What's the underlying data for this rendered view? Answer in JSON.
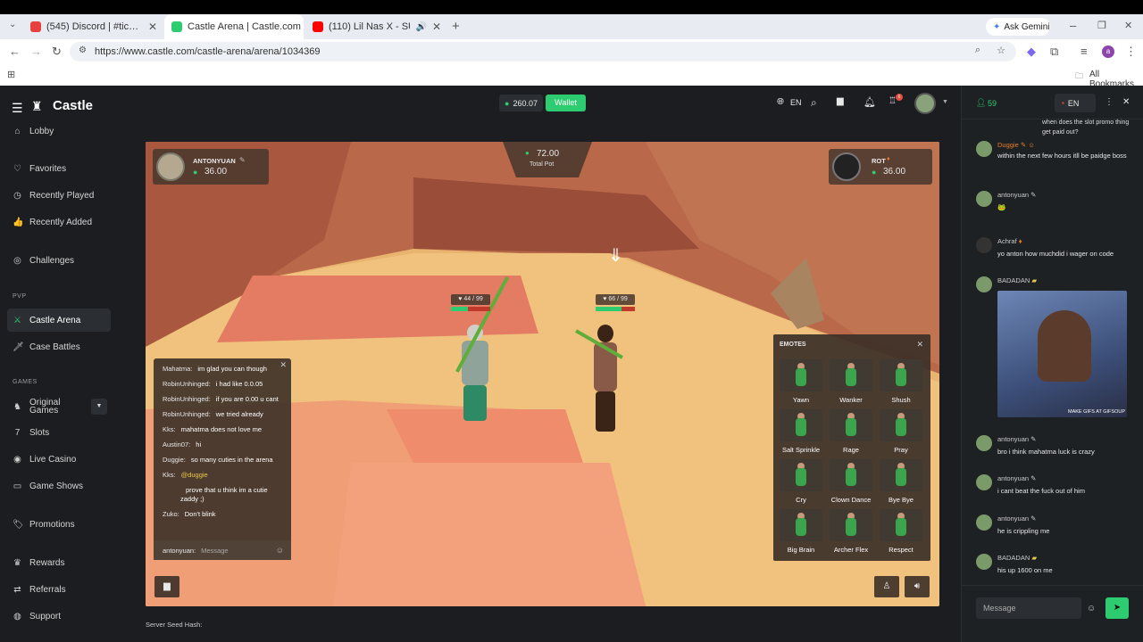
{
  "browser": {
    "tabs": [
      {
        "label": "(545) Discord | #ticket-0008 | c…",
        "icon": "discord-icon",
        "color": "#e8403f"
      },
      {
        "label": "Castle Arena | Castle.com",
        "icon": "castle-icon",
        "color": "#2ecc71"
      },
      {
        "label": "(110) Lil Nas X - SUN GOES…",
        "icon": "youtube-icon",
        "color": "#ff0000"
      }
    ],
    "gemini_label": "Ask Gemini",
    "url": "https://www.castle.com/castle-arena/arena/1034369",
    "bookmarks_label": "All Bookmarks",
    "profile_initial": "a"
  },
  "castle": {
    "brand": "Castle",
    "balance": "260.07",
    "wallet_label": "Wallet",
    "language": "EN",
    "notif_count": "6",
    "sidebar": {
      "items_top": [
        {
          "label": "Lobby",
          "icon": "lobby-icon"
        },
        {
          "label": "Favorites",
          "icon": "heart-icon"
        },
        {
          "label": "Recently Played",
          "icon": "clock-icon"
        },
        {
          "label": "Recently Added",
          "icon": "thumb-icon"
        },
        {
          "label": "Challenges",
          "icon": "target-icon"
        }
      ],
      "pvp_label": "PVP",
      "pvp_items": [
        {
          "label": "Castle Arena",
          "icon": "swords-icon"
        },
        {
          "label": "Case Battles",
          "icon": "sword-icon"
        }
      ],
      "games_label": "GAMES",
      "games_items": [
        {
          "label": "Original Games",
          "icon": "chess-icon"
        },
        {
          "label": "Slots",
          "icon": "slots-icon"
        },
        {
          "label": "Live Casino",
          "icon": "casino-icon"
        },
        {
          "label": "Game Shows",
          "icon": "shows-icon"
        }
      ],
      "bottom_items": [
        {
          "label": "Promotions",
          "icon": "tag-icon"
        },
        {
          "label": "Rewards",
          "icon": "crown-icon"
        },
        {
          "label": "Referrals",
          "icon": "share-icon"
        },
        {
          "label": "Support",
          "icon": "support-icon"
        }
      ]
    },
    "arena": {
      "player1": {
        "name": "ANTONYUAN",
        "amount": "36.00",
        "hp": "44 / 99",
        "hp_fraction": 0.44
      },
      "player2": {
        "name": "ROT",
        "amount": "36.00",
        "hp": "66 / 99",
        "hp_fraction": 0.67
      },
      "pot_amount": "72.00",
      "pot_label": "Total Pot",
      "chat": [
        {
          "user": "Mahatma:",
          "text": "im glad you can though"
        },
        {
          "user": "RobinUnhinged:",
          "text": "i had like 0.0.05"
        },
        {
          "user": "RobinUnhinged:",
          "text": "if you are 0.00 u cant"
        },
        {
          "user": "RobinUnhinged:",
          "text": "we tried already"
        },
        {
          "user": "Kks:",
          "text": "mahatma does not love me"
        },
        {
          "user": "Austin07:",
          "text": "hi"
        },
        {
          "user": "Duggie:",
          "text": "so many cuties in the arena"
        },
        {
          "user": "Kks:",
          "text": "@duggie"
        },
        {
          "user": "",
          "text": "prove that u think im a cutie zaddy ;)"
        },
        {
          "user": "Zuko:",
          "text": "Don't blink"
        }
      ],
      "chat_input_user": "antonyuan:",
      "chat_input_placeholder": "Message",
      "emotes_title": "EMOTES",
      "emotes": [
        "Yawn",
        "Wanker",
        "Shush",
        "Salt Sprinkle",
        "Rage",
        "Pray",
        "Cry",
        "Clown Dance",
        "Bye Bye",
        "Big Brain",
        "Archer Flex",
        "Respect"
      ]
    },
    "server_seed_label": "Server Seed Hash:"
  },
  "side_chat": {
    "online_count": "59",
    "language": "EN",
    "top_fragment": "when does the slot promo thing get paid out?",
    "messages": [
      {
        "user": "Duggie",
        "text": "within the next few hours itll be paidge boss"
      },
      {
        "user": "antonyuan",
        "text": "🐸"
      },
      {
        "user": "Achraf",
        "text": "yo anton how muchdid i wager on code"
      },
      {
        "user": "BADADAN",
        "text": ""
      },
      {
        "user": "antonyuan",
        "text": "bro i think mahatma luck is crazy"
      },
      {
        "user": "antonyuan",
        "text": "i cant beat the fuck out of him"
      },
      {
        "user": "antonyuan",
        "text": "he is crippling me"
      },
      {
        "user": "BADADAN",
        "text": "his up 1600 on me"
      }
    ],
    "gif_caption": "MAKE GIFS AT GIFSOUP",
    "input_placeholder": "Message"
  }
}
